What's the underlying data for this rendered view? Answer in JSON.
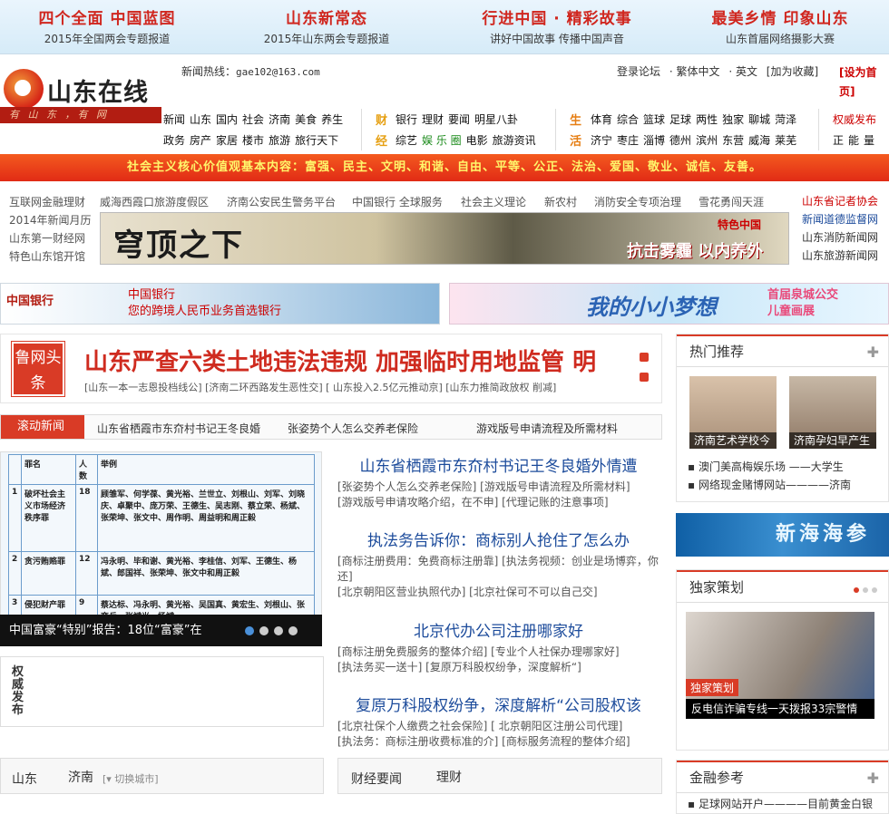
{
  "top_banner": [
    {
      "title": "四个全面 中国蓝图",
      "subtitle": "2015年全国两会专题报道"
    },
    {
      "title": "山东新常态",
      "subtitle": "2015年山东两会专题报道"
    },
    {
      "title": "行进中国 · 精彩故事",
      "subtitle": "讲好中国故事 传播中国声音"
    },
    {
      "title": "最美乡情 印象山东",
      "subtitle": "山东首届网络摄影大赛"
    }
  ],
  "logo": {
    "text": "山东在线",
    "slogan": "有 山 东 ，有 网"
  },
  "hotline": {
    "label": "新闻热线：",
    "email": "gae102@163.com"
  },
  "toplinks": [
    "登录论坛",
    "· 繁体中文",
    "· 英文",
    "[加为收藏]"
  ],
  "sethome": "[设为首页]",
  "nav": {
    "row1": [
      "新闻",
      "山东",
      "国内",
      "社会",
      "济南",
      "美食",
      "养生"
    ],
    "row2": [
      "政务",
      "房产",
      "家居",
      "楼市",
      "旅游",
      "旅行天下"
    ],
    "cai_label": "财",
    "jing_label": "经",
    "row3": [
      "银行",
      "理财",
      "要闻",
      "明星八卦"
    ],
    "row4": [
      "综艺",
      "娱 乐 圈",
      "电影",
      "旅游资讯"
    ],
    "sheng_label": "生",
    "huo_label": "活",
    "row5": [
      "体育",
      "综合",
      "篮球",
      "足球",
      "两性",
      "独家",
      "聊城",
      "菏泽"
    ],
    "row6": [
      "济宁",
      "枣庄",
      "淄博",
      "德州",
      "滨州",
      "东营",
      "威海",
      "莱芜"
    ],
    "row7": [
      "权威发布"
    ],
    "row8": [
      "正",
      "能",
      "量"
    ]
  },
  "lead": "社会主义核心价值观基本内容：富强、民主、文明、和谐、自由、平等、公正、法治、爱国、敬业、诚信、友善。",
  "left_links": [
    "互联网金融理财",
    "2014年新闻月历",
    "山东第一财经网",
    "特色山东馆开馆"
  ],
  "mid_links": [
    "威海西霞口旅游度假区",
    "济南公安民生警务平台",
    "中国银行 全球服务",
    "社会主义理论",
    "新农村",
    "消防安全专项治理",
    "雪花勇闯天涯"
  ],
  "main_ad": {
    "title": "穹顶之下",
    "cta": "抗击雾霾 以内养外",
    "brand": "特色中国"
  },
  "right_links": [
    "山东省记者协会",
    "新闻道德监督网",
    "山东消防新闻网",
    "山东旅游新闻网"
  ],
  "boc": {
    "logo": "中国银行",
    "line1": "中国银行",
    "line2": "您的跨境人民币业务首选银行"
  },
  "dream": {
    "text": "我的小小梦想",
    "line1": "首届泉城公交",
    "line2": "儿童画展"
  },
  "headline": {
    "badge": "鲁网头条",
    "title": "山东严查六类土地违法违规 加强临时用地监管 明",
    "links": "[山东一本一志恩投档线公] [济南二环西路发生恶性交] [ 山东投入2.5亿元推动京] [山东力推简政放权 削减]"
  },
  "scroll": {
    "label": "滚动新闻",
    "items": [
      "山东省栖霞市东夼村书记王冬良婚",
      "张姿势个人怎么交养老保险",
      "游戏版号申请流程及所需材料"
    ]
  },
  "slide": {
    "headers": [
      "罪名",
      "人数",
      "举例"
    ],
    "rows": [
      {
        "n": "1",
        "c": "破坏社会主义市场经济秩序罪",
        "p": "18",
        "e": "顾雏军、何学葆、黄光裕、兰世立、刘根山、刘军、刘晓庆、卓聚中、庞万荣、王德生、吴志刚、蔡立荣、杨斌、张荣坤、张文中、周作明、周益明和周正毅"
      },
      {
        "n": "2",
        "c": "贪污贿赂罪",
        "p": "12",
        "e": "冯永明、毕和谢、黄光裕、李桂信、刘军、王德生、杨斌、郎国祥、张荣坤、张文中和周正毅"
      },
      {
        "n": "3",
        "c": "侵犯财产罪",
        "p": "9",
        "e": "蔡达标、冯永明、黄光裕、吴国真、黄宏生、刘根山、张奕兵、张斌光、杨斌"
      }
    ],
    "caption": "中国富豪“特别”报告：18位“富豪”在"
  },
  "auth_box": "权威发布",
  "stories": [
    {
      "title": "山东省栖霞市东夼村书记王冬良婚外情遭",
      "links": [
        "[张姿势个人怎么交养老保险] [游戏版号申请流程及所需材料]",
        "[游戏版号申请攻略介绍，在不申] [代理记账的注意事项]"
      ]
    },
    {
      "title": "执法务告诉你：商标别人抢住了怎么办",
      "links": [
        "[商标注册费用：免费商标注册靠] [执法务视频：创业是场博弈，你还]",
        "[北京朝阳区营业执照代办] [北京社保可不可以自己交]"
      ]
    },
    {
      "title": "北京代办公司注册哪家好",
      "links": [
        "[商标注册免费服务的整体介绍] [专业个人社保办理哪家好]",
        "[执法务买一送十] [复原万科股权纷争，深度解析“]"
      ]
    },
    {
      "title": "复原万科股权纷争，深度解析“公司股权该",
      "links": [
        "[北京社保个人缴费之社会保险] [ 北京朝阳区注册公司代理]",
        "[执法务：商标注册收费标准的介] [商标服务流程的整体介绍]"
      ]
    }
  ],
  "bottom_tabs": {
    "left": [
      "山东",
      "济南"
    ],
    "switch": "[▾ 切换城市]",
    "mid": [
      "财经要闻",
      "理财"
    ]
  },
  "hot": {
    "title": "热门推荐",
    "photos": [
      "济南艺术学校今",
      "济南孕妇早产生"
    ],
    "links": [
      "澳门美高梅娱乐场 ——大学生",
      "网络现金赌博网站————济南"
    ]
  },
  "haishen": "新海海参",
  "exclusive": {
    "title": "独家策划",
    "tag": "独家策划",
    "caption": "反电信诈骗专线一天拨报33宗警情"
  },
  "finance": {
    "title": "金融参考",
    "link": "足球网站开户————目前黄金白银"
  }
}
